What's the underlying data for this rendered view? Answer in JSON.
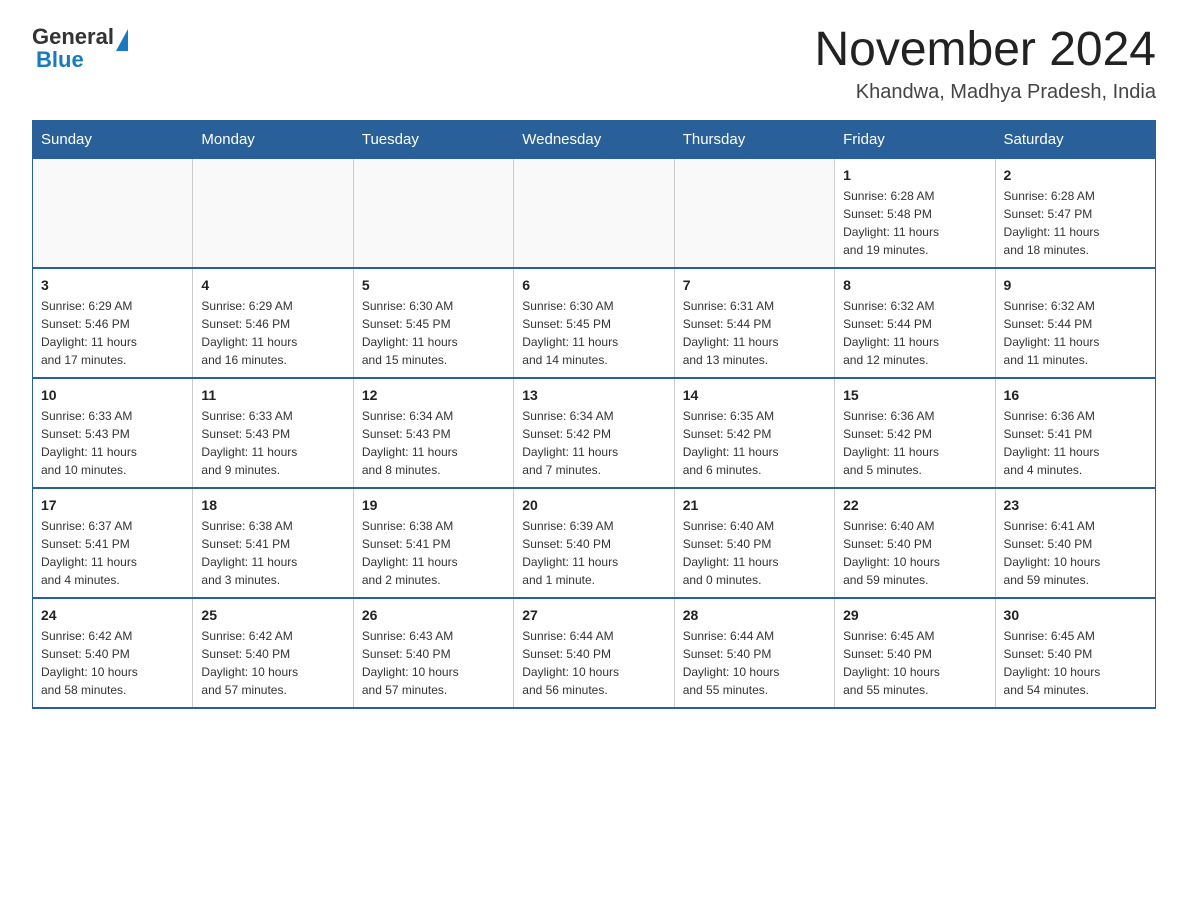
{
  "header": {
    "logo_general": "General",
    "logo_blue": "Blue",
    "title": "November 2024",
    "subtitle": "Khandwa, Madhya Pradesh, India"
  },
  "weekdays": [
    "Sunday",
    "Monday",
    "Tuesday",
    "Wednesday",
    "Thursday",
    "Friday",
    "Saturday"
  ],
  "weeks": [
    [
      {
        "day": "",
        "info": ""
      },
      {
        "day": "",
        "info": ""
      },
      {
        "day": "",
        "info": ""
      },
      {
        "day": "",
        "info": ""
      },
      {
        "day": "",
        "info": ""
      },
      {
        "day": "1",
        "info": "Sunrise: 6:28 AM\nSunset: 5:48 PM\nDaylight: 11 hours\nand 19 minutes."
      },
      {
        "day": "2",
        "info": "Sunrise: 6:28 AM\nSunset: 5:47 PM\nDaylight: 11 hours\nand 18 minutes."
      }
    ],
    [
      {
        "day": "3",
        "info": "Sunrise: 6:29 AM\nSunset: 5:46 PM\nDaylight: 11 hours\nand 17 minutes."
      },
      {
        "day": "4",
        "info": "Sunrise: 6:29 AM\nSunset: 5:46 PM\nDaylight: 11 hours\nand 16 minutes."
      },
      {
        "day": "5",
        "info": "Sunrise: 6:30 AM\nSunset: 5:45 PM\nDaylight: 11 hours\nand 15 minutes."
      },
      {
        "day": "6",
        "info": "Sunrise: 6:30 AM\nSunset: 5:45 PM\nDaylight: 11 hours\nand 14 minutes."
      },
      {
        "day": "7",
        "info": "Sunrise: 6:31 AM\nSunset: 5:44 PM\nDaylight: 11 hours\nand 13 minutes."
      },
      {
        "day": "8",
        "info": "Sunrise: 6:32 AM\nSunset: 5:44 PM\nDaylight: 11 hours\nand 12 minutes."
      },
      {
        "day": "9",
        "info": "Sunrise: 6:32 AM\nSunset: 5:44 PM\nDaylight: 11 hours\nand 11 minutes."
      }
    ],
    [
      {
        "day": "10",
        "info": "Sunrise: 6:33 AM\nSunset: 5:43 PM\nDaylight: 11 hours\nand 10 minutes."
      },
      {
        "day": "11",
        "info": "Sunrise: 6:33 AM\nSunset: 5:43 PM\nDaylight: 11 hours\nand 9 minutes."
      },
      {
        "day": "12",
        "info": "Sunrise: 6:34 AM\nSunset: 5:43 PM\nDaylight: 11 hours\nand 8 minutes."
      },
      {
        "day": "13",
        "info": "Sunrise: 6:34 AM\nSunset: 5:42 PM\nDaylight: 11 hours\nand 7 minutes."
      },
      {
        "day": "14",
        "info": "Sunrise: 6:35 AM\nSunset: 5:42 PM\nDaylight: 11 hours\nand 6 minutes."
      },
      {
        "day": "15",
        "info": "Sunrise: 6:36 AM\nSunset: 5:42 PM\nDaylight: 11 hours\nand 5 minutes."
      },
      {
        "day": "16",
        "info": "Sunrise: 6:36 AM\nSunset: 5:41 PM\nDaylight: 11 hours\nand 4 minutes."
      }
    ],
    [
      {
        "day": "17",
        "info": "Sunrise: 6:37 AM\nSunset: 5:41 PM\nDaylight: 11 hours\nand 4 minutes."
      },
      {
        "day": "18",
        "info": "Sunrise: 6:38 AM\nSunset: 5:41 PM\nDaylight: 11 hours\nand 3 minutes."
      },
      {
        "day": "19",
        "info": "Sunrise: 6:38 AM\nSunset: 5:41 PM\nDaylight: 11 hours\nand 2 minutes."
      },
      {
        "day": "20",
        "info": "Sunrise: 6:39 AM\nSunset: 5:40 PM\nDaylight: 11 hours\nand 1 minute."
      },
      {
        "day": "21",
        "info": "Sunrise: 6:40 AM\nSunset: 5:40 PM\nDaylight: 11 hours\nand 0 minutes."
      },
      {
        "day": "22",
        "info": "Sunrise: 6:40 AM\nSunset: 5:40 PM\nDaylight: 10 hours\nand 59 minutes."
      },
      {
        "day": "23",
        "info": "Sunrise: 6:41 AM\nSunset: 5:40 PM\nDaylight: 10 hours\nand 59 minutes."
      }
    ],
    [
      {
        "day": "24",
        "info": "Sunrise: 6:42 AM\nSunset: 5:40 PM\nDaylight: 10 hours\nand 58 minutes."
      },
      {
        "day": "25",
        "info": "Sunrise: 6:42 AM\nSunset: 5:40 PM\nDaylight: 10 hours\nand 57 minutes."
      },
      {
        "day": "26",
        "info": "Sunrise: 6:43 AM\nSunset: 5:40 PM\nDaylight: 10 hours\nand 57 minutes."
      },
      {
        "day": "27",
        "info": "Sunrise: 6:44 AM\nSunset: 5:40 PM\nDaylight: 10 hours\nand 56 minutes."
      },
      {
        "day": "28",
        "info": "Sunrise: 6:44 AM\nSunset: 5:40 PM\nDaylight: 10 hours\nand 55 minutes."
      },
      {
        "day": "29",
        "info": "Sunrise: 6:45 AM\nSunset: 5:40 PM\nDaylight: 10 hours\nand 55 minutes."
      },
      {
        "day": "30",
        "info": "Sunrise: 6:45 AM\nSunset: 5:40 PM\nDaylight: 10 hours\nand 54 minutes."
      }
    ]
  ]
}
